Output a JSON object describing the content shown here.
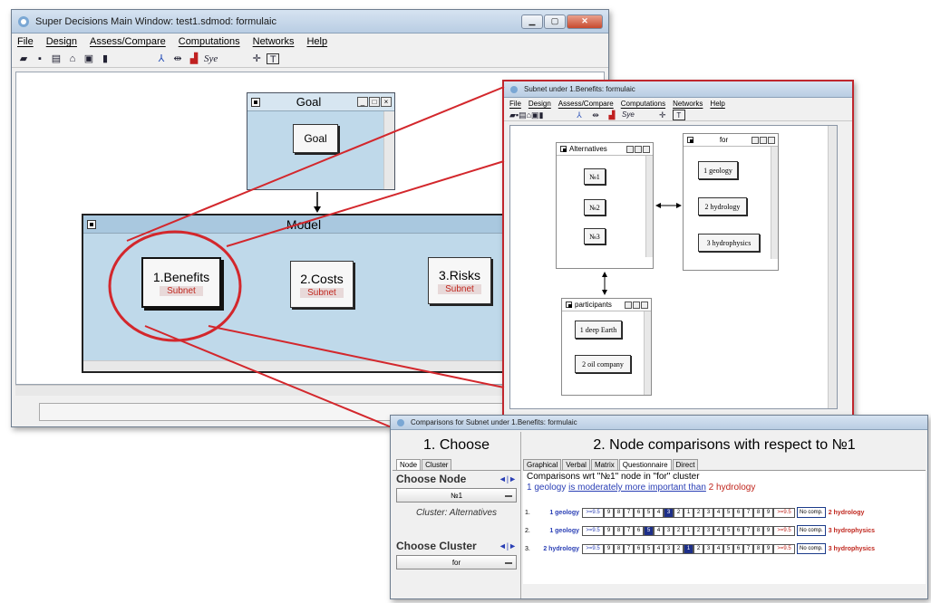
{
  "main": {
    "title": "Super Decisions Main Window: test1.sdmod: formulaic",
    "menus": [
      "File",
      "Design",
      "Assess/Compare",
      "Computations",
      "Networks",
      "Help"
    ],
    "toolbar_text": "Sye",
    "goal_cluster": {
      "title": "Goal",
      "node": "Goal"
    },
    "model_cluster": {
      "title": "Model"
    },
    "nodes": [
      {
        "label": "1.Benefits",
        "sub": "Subnet"
      },
      {
        "label": "2.Costs",
        "sub": "Subnet"
      },
      {
        "label": "3.Risks",
        "sub": "Subnet"
      }
    ]
  },
  "subnet": {
    "title": "Subnet under 1.Benefits: formulaic",
    "menus": [
      "File",
      "Design",
      "Assess/Compare",
      "Computations",
      "Networks",
      "Help"
    ],
    "toolbar_text": "Sye",
    "alternatives": {
      "title": "Alternatives",
      "nodes": [
        "№1",
        "№2",
        "№3"
      ]
    },
    "for": {
      "title": "for",
      "nodes": [
        "1 geology",
        "2 hydrology",
        "3 hydrophysics"
      ]
    },
    "participants": {
      "title": "participants",
      "nodes": [
        "1 deep Earth",
        "2 oil company"
      ]
    }
  },
  "comparisons": {
    "title": "Comparisons for Subnet under 1.Benefits: formulaic",
    "left_header": "1. Choose",
    "right_header": "2. Node comparisons with respect to №1",
    "left_tabs": [
      "Node",
      "Cluster"
    ],
    "right_tabs": [
      "Graphical",
      "Verbal",
      "Matrix",
      "Questionnaire",
      "Direct"
    ],
    "choose_node_label": "Choose Node",
    "node_value": "№1",
    "cluster_caption": "Cluster: Alternatives",
    "choose_cluster_label": "Choose Cluster",
    "cluster_value": "for",
    "arrows": "◄|►",
    "desc": "Comparisons wrt \"№1\" node in \"for\" cluster",
    "statement": {
      "left": "1 geology",
      "mid": "is moderately more important than",
      "right": "2 hydrology"
    },
    "scale": [
      ">=9.5",
      "9",
      "8",
      "7",
      "6",
      "5",
      "4",
      "3",
      "2",
      "1",
      "2",
      "3",
      "4",
      "5",
      "6",
      "7",
      "8",
      "9",
      ">=9.5"
    ],
    "no_comp": "No comp.",
    "rows": [
      {
        "n": "1.",
        "left": "1 geology",
        "right": "2 hydrology",
        "selected": 7
      },
      {
        "n": "2.",
        "left": "1 geology",
        "right": "3 hydrophysics",
        "selected": 5
      },
      {
        "n": "3.",
        "left": "2 hydrology",
        "right": "3 hydrophysics",
        "selected": 9
      }
    ]
  },
  "colors": {
    "highlight": "#d3272c",
    "cluster_bg": "#bfd9ea"
  }
}
